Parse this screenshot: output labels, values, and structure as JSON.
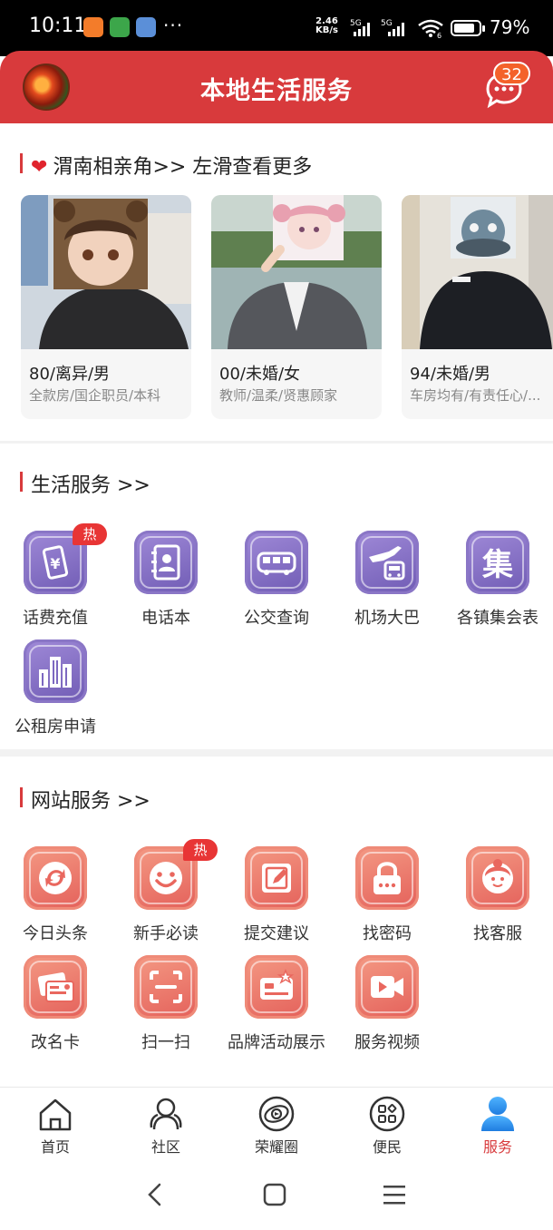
{
  "status_bar": {
    "time": "10:11",
    "dots": "···",
    "net_speed_value": "2.46",
    "net_speed_unit": "KB/s",
    "sim1": "5G",
    "sim2": "5G",
    "wifi_label": "6",
    "battery": "79%"
  },
  "header": {
    "title": "本地生活服务",
    "message_count": "32"
  },
  "dating": {
    "title": "渭南相亲角>> 左滑查看更多",
    "profiles": [
      {
        "main": "80/离异/男",
        "sub": "全款房/国企职员/本科"
      },
      {
        "main": "00/未婚/女",
        "sub": "教师/温柔/贤惠顾家"
      },
      {
        "main": "94/未婚/男",
        "sub": "车房均有/有责任心/..."
      }
    ]
  },
  "life_services": {
    "title": "生活服务 >>",
    "hot_label": "热",
    "items": [
      {
        "label": "话费充值",
        "icon": "phone-recharge-icon"
      },
      {
        "label": "电话本",
        "icon": "phonebook-icon"
      },
      {
        "label": "公交查询",
        "icon": "bus-icon"
      },
      {
        "label": "机场大巴",
        "icon": "airport-bus-icon"
      },
      {
        "label": "各镇集会表",
        "icon": "market-icon",
        "glyph": "集"
      },
      {
        "label": "公租房申请",
        "icon": "public-housing-icon"
      }
    ]
  },
  "web_services": {
    "title": "网站服务 >>",
    "hot_label": "热",
    "items": [
      {
        "label": "今日头条",
        "icon": "refresh-icon"
      },
      {
        "label": "新手必读",
        "icon": "smiley-icon"
      },
      {
        "label": "提交建议",
        "icon": "edit-icon"
      },
      {
        "label": "找密码",
        "icon": "lock-icon"
      },
      {
        "label": "找客服",
        "icon": "customer-service-icon"
      },
      {
        "label": "改名卡",
        "icon": "rename-card-icon"
      },
      {
        "label": "扫一扫",
        "icon": "scan-icon"
      },
      {
        "label": "品牌活动展示",
        "icon": "brand-card-icon"
      },
      {
        "label": "服务视频",
        "icon": "video-icon"
      }
    ]
  },
  "bottom_nav": {
    "items": [
      {
        "label": "首页",
        "icon": "home-icon"
      },
      {
        "label": "社区",
        "icon": "community-icon"
      },
      {
        "label": "荣耀圈",
        "icon": "honor-circle-icon"
      },
      {
        "label": "便民",
        "icon": "convenience-icon"
      },
      {
        "label": "服务",
        "icon": "user-icon",
        "active": true
      }
    ]
  },
  "colors": {
    "brand_red": "#d83a3c",
    "purple_icon": "#7c68c0",
    "orange_icon": "#e9675e",
    "hot_badge": "#e83535"
  }
}
